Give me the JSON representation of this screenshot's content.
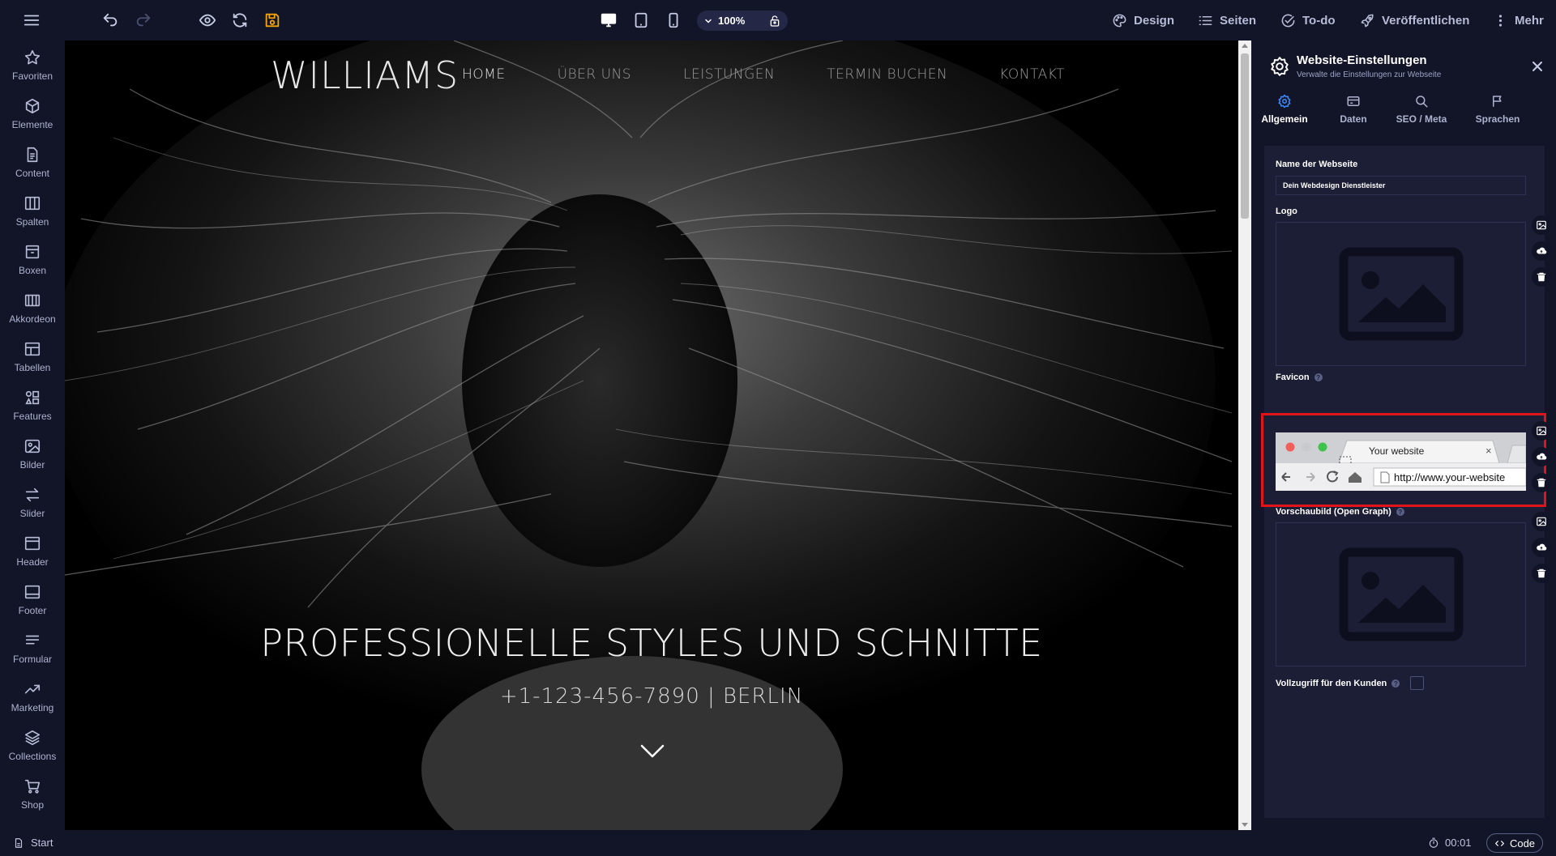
{
  "toolbar": {
    "zoom": "100%",
    "actions": [
      {
        "label": "Design",
        "icon": "palette-icon"
      },
      {
        "label": "Seiten",
        "icon": "list-icon"
      },
      {
        "label": "To-do",
        "icon": "check-circle-icon"
      },
      {
        "label": "Veröffentlichen",
        "icon": "rocket-icon"
      },
      {
        "label": "Mehr",
        "icon": "vertical-dots-icon"
      }
    ],
    "save_color": "#f0a30a"
  },
  "sidebar": {
    "items": [
      {
        "label": "Favoriten",
        "icon": "star-icon"
      },
      {
        "label": "Elemente",
        "icon": "cube-icon"
      },
      {
        "label": "Content",
        "icon": "document-icon"
      },
      {
        "label": "Spalten",
        "icon": "columns-icon"
      },
      {
        "label": "Boxen",
        "icon": "box-icon"
      },
      {
        "label": "Akkordeon",
        "icon": "accordion-icon"
      },
      {
        "label": "Tabellen",
        "icon": "table-icon"
      },
      {
        "label": "Features",
        "icon": "features-icon"
      },
      {
        "label": "Bilder",
        "icon": "image-icon"
      },
      {
        "label": "Slider",
        "icon": "slider-arrows-icon"
      },
      {
        "label": "Header",
        "icon": "header-icon"
      },
      {
        "label": "Footer",
        "icon": "footer-icon"
      },
      {
        "label": "Formular",
        "icon": "form-icon"
      },
      {
        "label": "Marketing",
        "icon": "trend-icon"
      },
      {
        "label": "Collections",
        "icon": "layers-icon"
      },
      {
        "label": "Shop",
        "icon": "cart-icon"
      }
    ]
  },
  "website": {
    "logo": "WILLIAMS",
    "nav": [
      "HOME",
      "ÜBER UNS",
      "LEISTUNGEN",
      "TERMIN BUCHEN",
      "KONTAKT"
    ],
    "headline": "PROFESSIONELLE STYLES UND SCHNITTE",
    "subline": "+1-123-456-7890 | BERLIN"
  },
  "panel": {
    "title": "Website-Einstellungen",
    "subtitle": "Verwalte die Einstellungen zur Webseite",
    "tabs": [
      {
        "label": "Allgemein",
        "icon": "gear-icon",
        "active": true
      },
      {
        "label": "Daten",
        "icon": "card-icon",
        "active": false
      },
      {
        "label": "SEO / Meta",
        "icon": "search-icon",
        "active": false
      },
      {
        "label": "Sprachen",
        "icon": "flag-icon",
        "active": false
      }
    ],
    "site_name_label": "Name der Webseite",
    "site_name_value": "Dein Webdesign Dienstleister",
    "logo_label": "Logo",
    "favicon_label": "Favicon",
    "favicon_tab_title": "Your website",
    "favicon_url": "http://www.your-website",
    "og_label": "Vorschaubild (Open Graph)",
    "full_access_label": "Vollzugriff für den Kunden",
    "full_access_checked": false,
    "help_glyph": "?",
    "tab_close_glyph": "×",
    "highlight_color": "#e1141c",
    "accent_color": "#3d8bff"
  },
  "bottombar": {
    "start_label": "Start",
    "timer": "00:01",
    "code_label": "Code"
  }
}
